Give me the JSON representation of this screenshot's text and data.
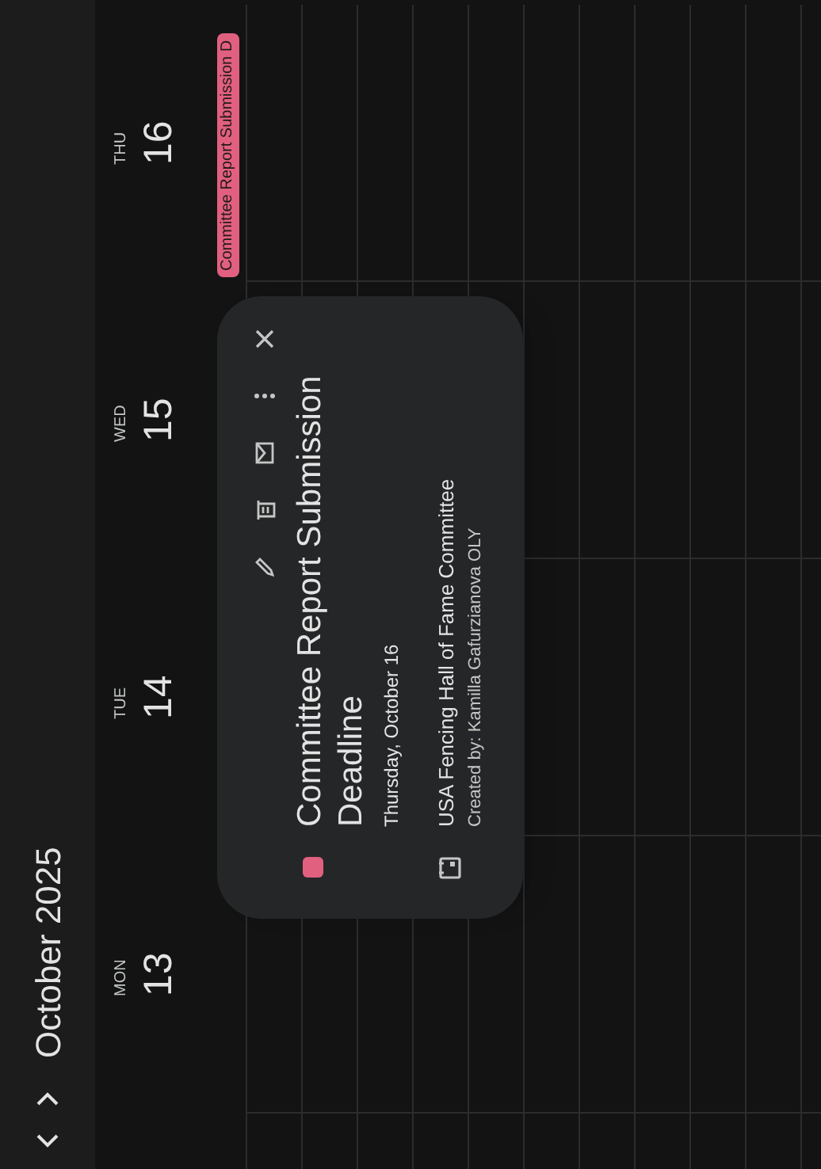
{
  "header": {
    "month_title": "October 2025"
  },
  "days": [
    {
      "weekday": "MON",
      "date": "13"
    },
    {
      "weekday": "TUE",
      "date": "14"
    },
    {
      "weekday": "WED",
      "date": "15"
    },
    {
      "weekday": "THU",
      "date": "16",
      "events": [
        {
          "title": "Committee Report Submission D",
          "color": "#e2607f"
        }
      ]
    }
  ],
  "popup": {
    "title": "Committee Report Submission Deadline",
    "color": "#e2607f",
    "date": "Thursday, October 16",
    "calendar": "USA Fencing Hall of Fame Committee",
    "created_by": "Created by: Kamilla Gafurzianova OLY"
  }
}
